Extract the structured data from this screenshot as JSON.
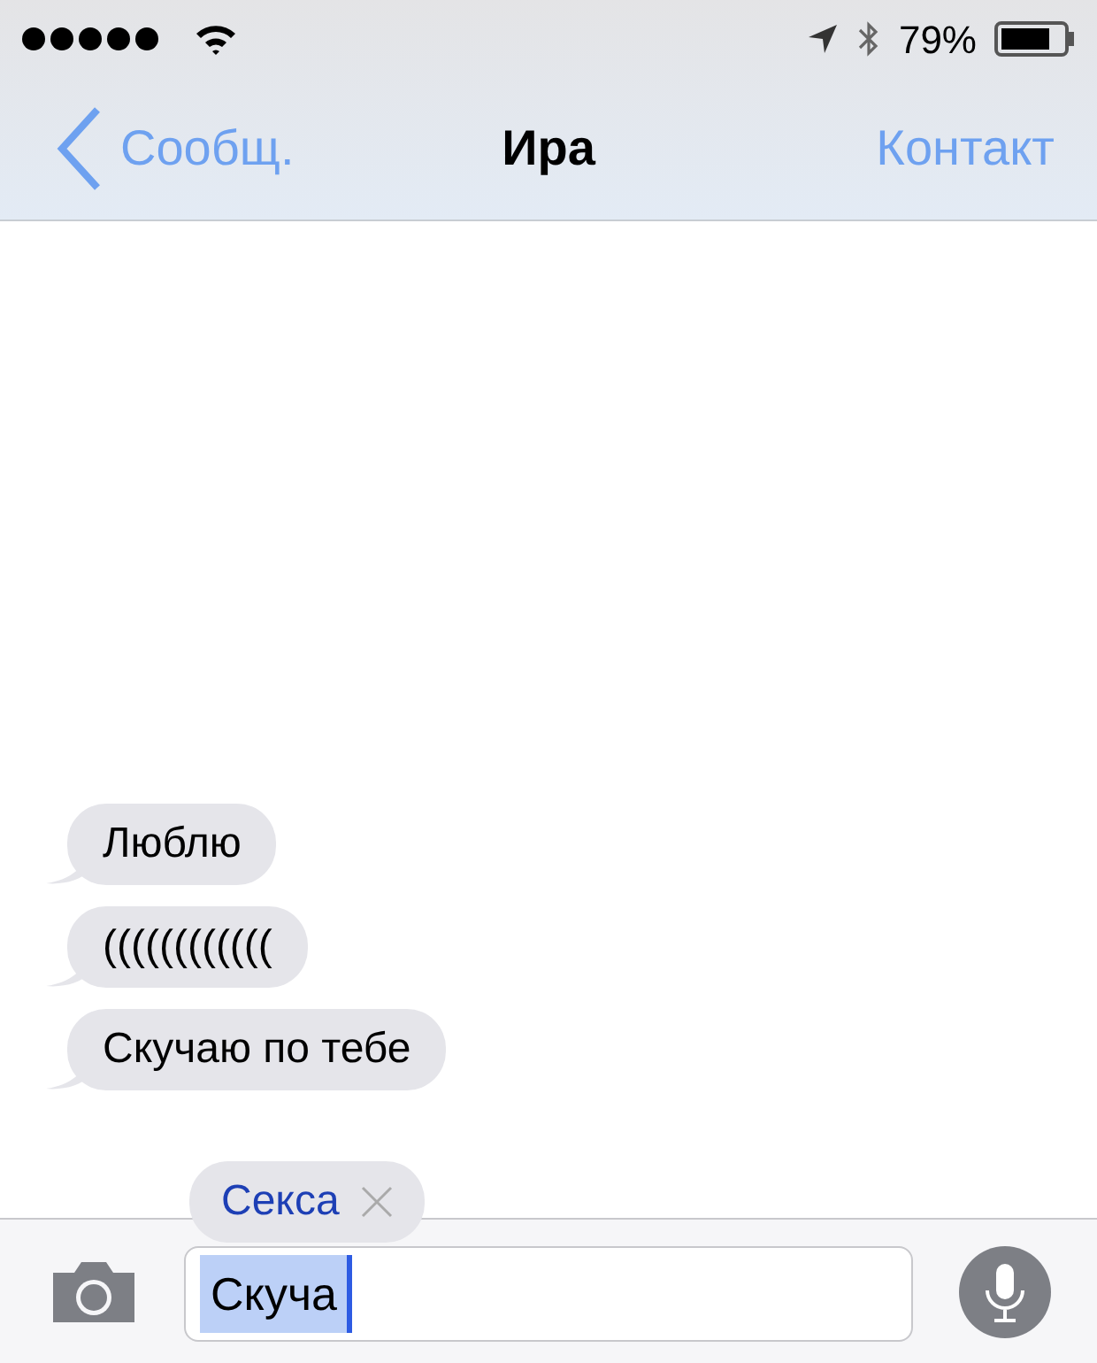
{
  "status_bar": {
    "battery": "79%"
  },
  "nav": {
    "back": "Сообщ.",
    "title": "Ира",
    "action": "Контакт"
  },
  "messages": [
    {
      "text": "Люблю"
    },
    {
      "text": "(((((((((((("
    },
    {
      "text": "Скучаю по тебе"
    }
  ],
  "suggestion": {
    "text": "Секса"
  },
  "input": {
    "value": "Скуча",
    "highlighted": true
  }
}
